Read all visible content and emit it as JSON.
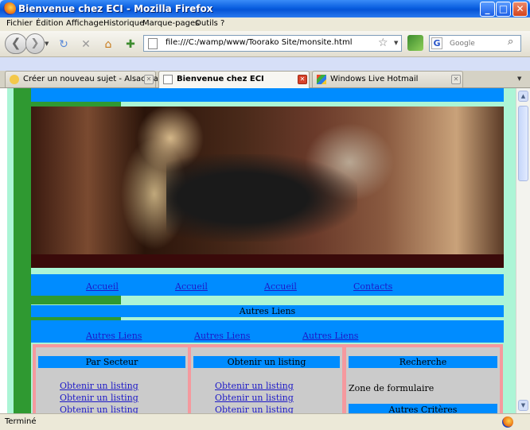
{
  "window": {
    "title": "Bienvenue chez ECI - Mozilla Firefox"
  },
  "menu": {
    "items": [
      "Fichier",
      "Édition",
      "Affichage",
      "Historique",
      "Marque-pages",
      "Outils",
      "?"
    ]
  },
  "toolbar": {
    "url": "file:///C:/wamp/www/Toorako Site/monsite.html",
    "search_placeholder": "Google",
    "search_engine_letter": "G"
  },
  "tabs": [
    {
      "label": "Créer un nouveau sujet - Alsacréations",
      "active": false
    },
    {
      "label": "Bienvenue chez ECI",
      "active": true
    },
    {
      "label": "Windows Live Hotmail",
      "active": false
    }
  ],
  "page": {
    "nav1": [
      "Accueil",
      "Accueil",
      "Accueil",
      "Contacts"
    ],
    "autres_liens_title": "Autres Liens",
    "nav2": [
      "Autres Liens",
      "Autres Liens",
      "Autres Liens"
    ],
    "columns": [
      {
        "title": "Par Secteur",
        "links": [
          "Obtenir un listing",
          "Obtenir un listing",
          "Obtenir un listing"
        ]
      },
      {
        "title": "Obtenir un listing",
        "links": [
          "Obtenir un listing",
          "Obtenir un listing",
          "Obtenir un listing"
        ]
      },
      {
        "title": "Recherche",
        "form_text": "Zone de formulaire",
        "criteria_title": "Autres Critères"
      }
    ]
  },
  "status": {
    "text": "Terminé"
  },
  "colors": {
    "blue_band": "#008cff",
    "mint": "#acf5d6",
    "green": "#2f9931",
    "pink": "#f5999e",
    "link": "#1d19c7"
  }
}
